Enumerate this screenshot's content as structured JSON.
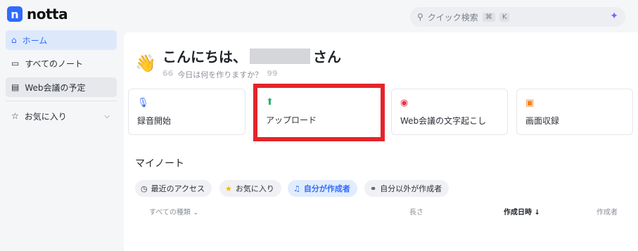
{
  "app": {
    "logo_letter": "n",
    "name": "notta"
  },
  "search": {
    "placeholder": "クイック検索",
    "key1": "⌘",
    "key2": "K"
  },
  "sidebar": {
    "items": [
      {
        "label": "ホーム",
        "icon": "home-icon"
      },
      {
        "label": "すべてのノート",
        "icon": "folder-icon"
      },
      {
        "label": "Web会議の予定",
        "icon": "calendar-icon"
      },
      {
        "label": "お気に入り",
        "icon": "star-icon"
      }
    ]
  },
  "main": {
    "greeting_prefix": "こんにちは、",
    "greeting_suffix": "さん",
    "greeting_emoji": "👋",
    "subtitle": "今日は何を作りますか？",
    "quote_open": "66",
    "quote_close": "99",
    "actions": [
      {
        "label": "録音開始",
        "icon": "microphone-icon",
        "color": "#2f6bff"
      },
      {
        "label": "アップロード",
        "icon": "upload-file-icon",
        "color": "#22b36b"
      },
      {
        "label": "Web会議の文字起こし",
        "icon": "meeting-icon",
        "color": "#e8334a"
      },
      {
        "label": "画面収録",
        "icon": "screen-record-icon",
        "color": "#f58220"
      }
    ],
    "notes_title": "マイノート",
    "filters": [
      {
        "label": "最近のアクセス",
        "icon": "clock-icon"
      },
      {
        "label": "お気に入り",
        "icon": "star-icon"
      },
      {
        "label": "自分が作成者",
        "icon": "headphones-icon",
        "active": true
      },
      {
        "label": "自分以外が作成者",
        "icon": "link-icon"
      }
    ],
    "columns": {
      "type": "すべての種類 ⌄",
      "length": "長さ",
      "created": "作成日時 ↓",
      "creator": "作成者"
    }
  },
  "colors": {
    "accent": "#2f6bff",
    "highlight": "#e4242b"
  }
}
